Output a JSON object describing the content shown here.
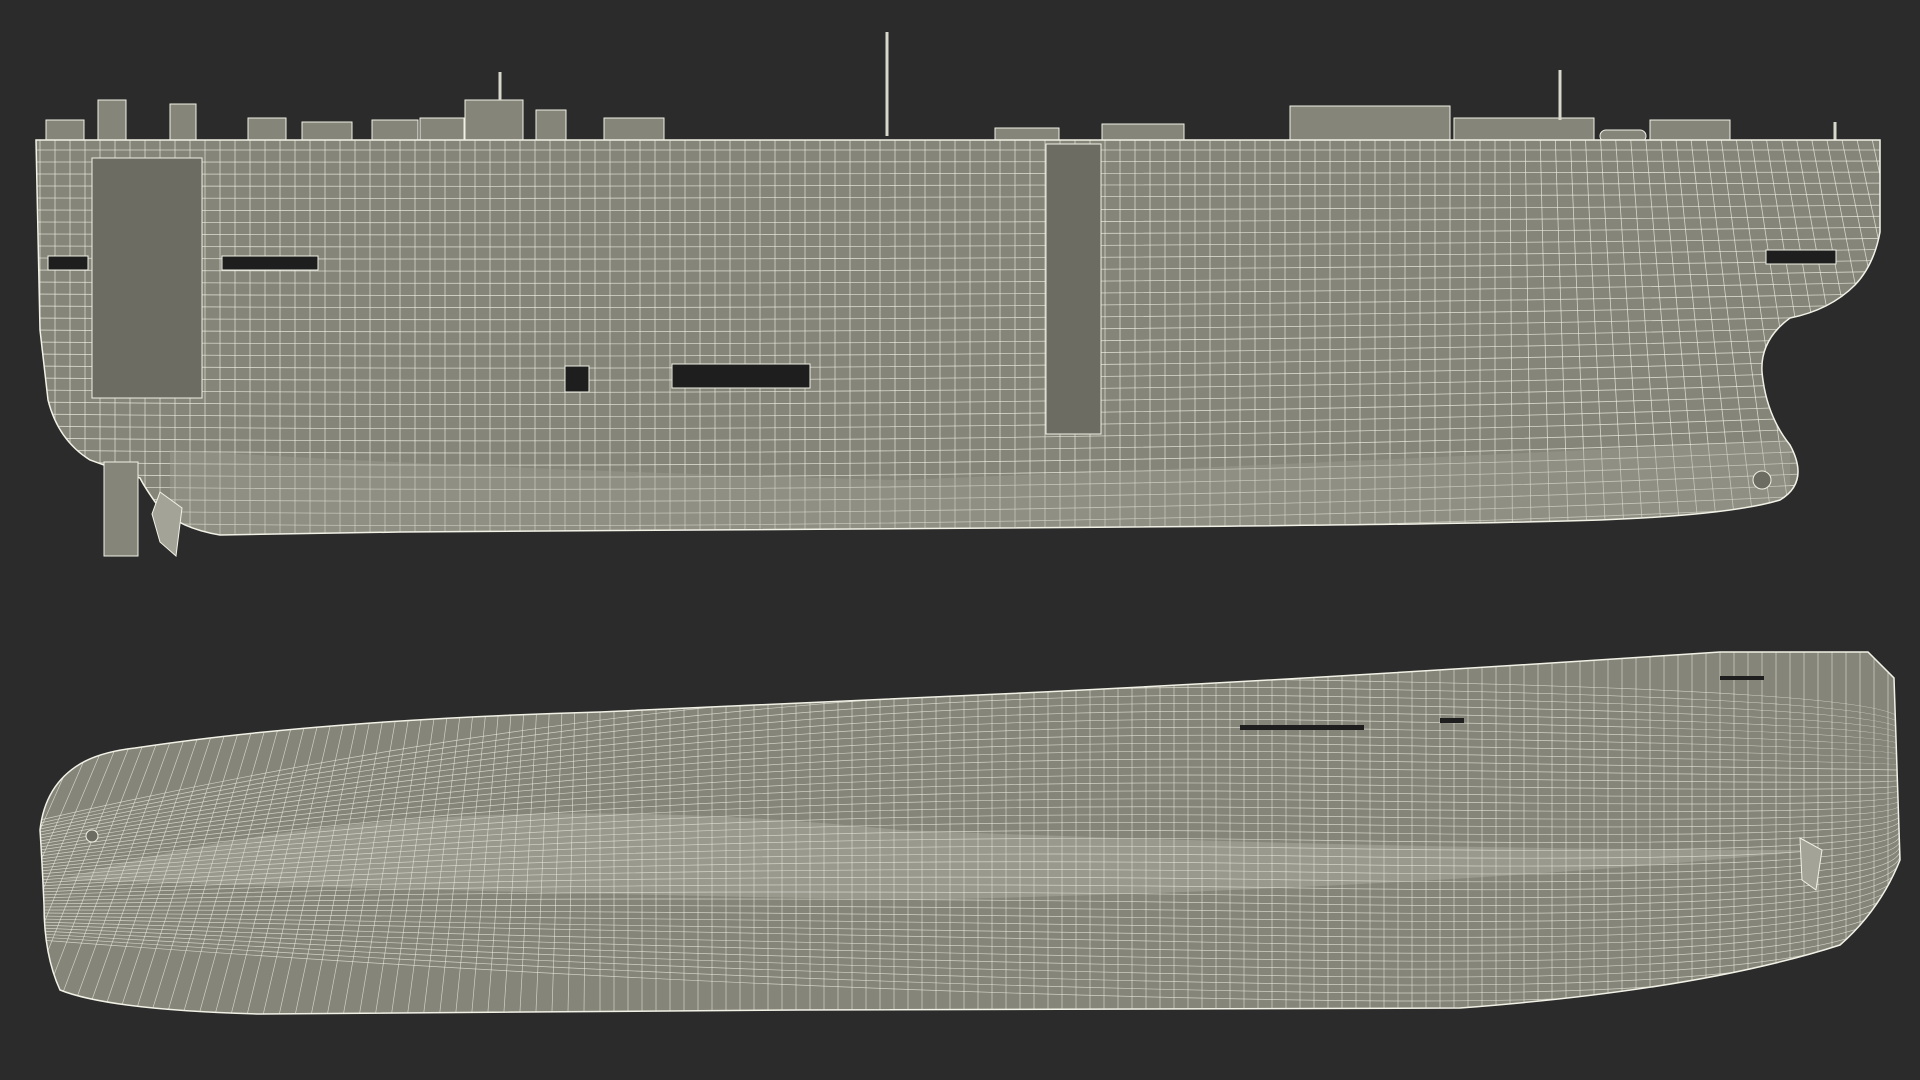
{
  "scene": {
    "background": "#2b2b2b",
    "hull_fill": "#85857a",
    "hull_fill_light": "#a3a397",
    "wire_color": "#f2f1e6",
    "dark_detail": "#1e1e1e"
  },
  "views": [
    {
      "name": "side-elevation"
    },
    {
      "name": "bottom-view"
    }
  ]
}
